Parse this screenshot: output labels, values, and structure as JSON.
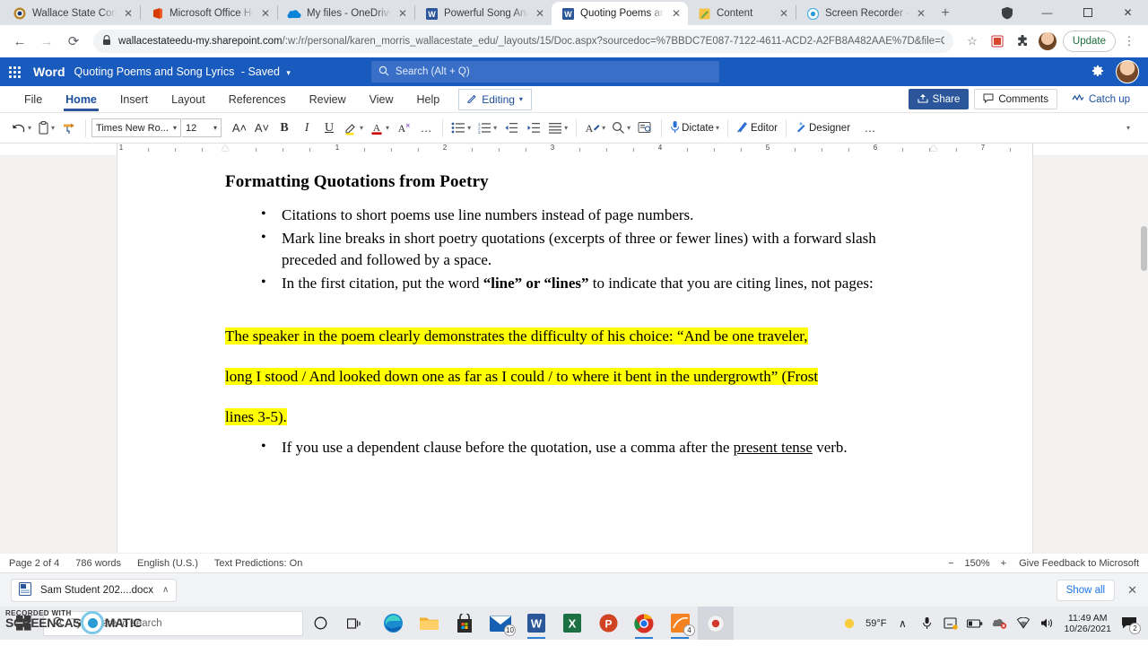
{
  "browser": {
    "tabs": [
      {
        "title": "Wallace State Commu",
        "icon": "wallace-favicon",
        "active": false
      },
      {
        "title": "Microsoft Office Hom",
        "icon": "office-favicon",
        "active": false
      },
      {
        "title": "My files - OneDrive",
        "icon": "onedrive-favicon",
        "active": false
      },
      {
        "title": "Powerful Song Analys",
        "icon": "word-favicon",
        "active": false
      },
      {
        "title": "Quoting Poems and S",
        "icon": "word-favicon",
        "active": true
      },
      {
        "title": "Content",
        "icon": "content-favicon",
        "active": false
      },
      {
        "title": "Screen Recorder - Scr",
        "icon": "recorder-favicon",
        "active": false
      }
    ],
    "new_tab_label": "+",
    "window_controls": {
      "minimize": "—",
      "maximize": "❐",
      "close": "✕"
    },
    "nav": {
      "back": "←",
      "forward": "→",
      "reload": "⟳"
    },
    "url_main": "wallacestateedu-my.sharepoint.com",
    "url_path": "/:w:/r/personal/karen_morris_wallacestate_edu/_layouts/15/Doc.aspx?sourcedoc=%7BBDC7E087-7122-4611-ACD2-A2FB8A482AAE%7D&file=Quoting...",
    "lock_icon": "🔒",
    "star_icon": "☆",
    "extension_icon": "puzzle-piece",
    "update_label": "Update",
    "menu_icon": "⋮"
  },
  "word": {
    "app_name": "Word",
    "document_title": "Quoting Poems and Song Lyrics",
    "save_state": "- Saved",
    "search_placeholder": "Search (Alt + Q)",
    "ribbon_tabs": [
      {
        "label": "File",
        "active": false
      },
      {
        "label": "Home",
        "active": true
      },
      {
        "label": "Insert",
        "active": false
      },
      {
        "label": "Layout",
        "active": false
      },
      {
        "label": "References",
        "active": false
      },
      {
        "label": "Review",
        "active": false
      },
      {
        "label": "View",
        "active": false
      },
      {
        "label": "Help",
        "active": false
      }
    ],
    "editing_mode": "Editing",
    "share_label": "Share",
    "comments_label": "Comments",
    "catchup_label": "Catch up",
    "toolbar": {
      "undo": "undo-icon",
      "paste": "paste-icon",
      "format_painter": "format-painter-icon",
      "font_name": "Times New Ro...",
      "font_size": "12",
      "grow_font": "A˄",
      "shrink_font": "A˅",
      "bold": "B",
      "italic": "I",
      "underline": "U",
      "highlight": "highlighter-icon",
      "font_color": "A",
      "clear_format": "clear-formatting-icon",
      "more": "…",
      "bullets": "bullet-list-icon",
      "numbering": "numbered-list-icon",
      "decrease_indent": "decrease-indent-icon",
      "increase_indent": "increase-indent-icon",
      "align": "align-icon",
      "styles": "styles-icon",
      "find": "find-icon",
      "immersive_reader": "immersive-reader-icon",
      "dictate_label": "Dictate",
      "editor_label": "Editor",
      "designer_label": "Designer",
      "overflow": "…"
    },
    "ruler_numbers": [
      "1",
      "1",
      "2",
      "3",
      "4",
      "5",
      "6",
      "7"
    ],
    "status": {
      "page": "Page 2 of 4",
      "words": "786 words",
      "language": "English (U.S.)",
      "predictions": "Text Predictions: On",
      "zoom_out": "−",
      "zoom_level": "150%",
      "zoom_in": "+",
      "feedback": "Give Feedback to Microsoft"
    }
  },
  "document": {
    "heading": "Formatting Quotations from Poetry",
    "bullets_1": [
      [
        {
          "t": "Citations to short poems use line numbers instead of page numbers.",
          "b": false
        }
      ],
      [
        {
          "t": "Mark line breaks in short poetry quotations (excerpts of three or fewer lines) with a forward slash preceded and followed by a space.",
          "b": false
        }
      ],
      [
        {
          "t": "In the first citation, put the word ",
          "b": false
        },
        {
          "t": "“line” or “lines”",
          "b": true
        },
        {
          "t": " to indicate that you are citing lines, not pages:",
          "b": false
        }
      ]
    ],
    "quote_lines": [
      "The speaker in the poem clearly demonstrates the difficulty of his choice: “And be one traveler,",
      "long I stood / And looked down one as far as I could / to where it bent in the undergrowth” (Frost",
      "lines 3-5)."
    ],
    "bullet_2_pre": "If you use a dependent clause before the quotation, use a comma after the ",
    "bullet_2_underlined": "present tense",
    "bullet_2_post": " verb.",
    "highlight_color": "#ffff00"
  },
  "downloads": {
    "file_name": "Sam Student 202....docx",
    "file_icon": "word-doc-icon",
    "expand_icon": "∧",
    "show_all": "Show all",
    "close_icon": "✕"
  },
  "taskbar": {
    "start_icon": "windows-start-icon",
    "search_placeholder": "Type here to search",
    "task_view": "task-view-icon",
    "cortana": "cortana-circle-icon",
    "apps": [
      {
        "name": "edge-icon",
        "badge": ""
      },
      {
        "name": "file-explorer-icon",
        "badge": ""
      },
      {
        "name": "microsoft-store-icon",
        "badge": ""
      },
      {
        "name": "mail-icon",
        "badge": "10"
      },
      {
        "name": "word-icon",
        "badge": ""
      },
      {
        "name": "excel-icon",
        "badge": ""
      },
      {
        "name": "powerpoint-icon",
        "badge": ""
      },
      {
        "name": "chrome-icon",
        "badge": ""
      },
      {
        "name": "screencast-o-matic-icon",
        "badge": "4"
      },
      {
        "name": "recorder-icon",
        "badge": ""
      }
    ],
    "tray": {
      "weather_temp": "59°F",
      "weather_icon": "sun-icon",
      "chevron": "∧",
      "mic": "microphone-icon",
      "onedrive": "onedrive-tray-icon",
      "battery": "battery-icon",
      "cloud": "cloud-error-icon",
      "wifi": "wifi-icon",
      "volume": "speaker-icon",
      "time": "11:49 AM",
      "date": "10/26/2021",
      "notifications_count": "2"
    }
  },
  "watermark": {
    "line1": "RECORDED WITH",
    "line2": "SCREENCAST-O-MATIC"
  }
}
